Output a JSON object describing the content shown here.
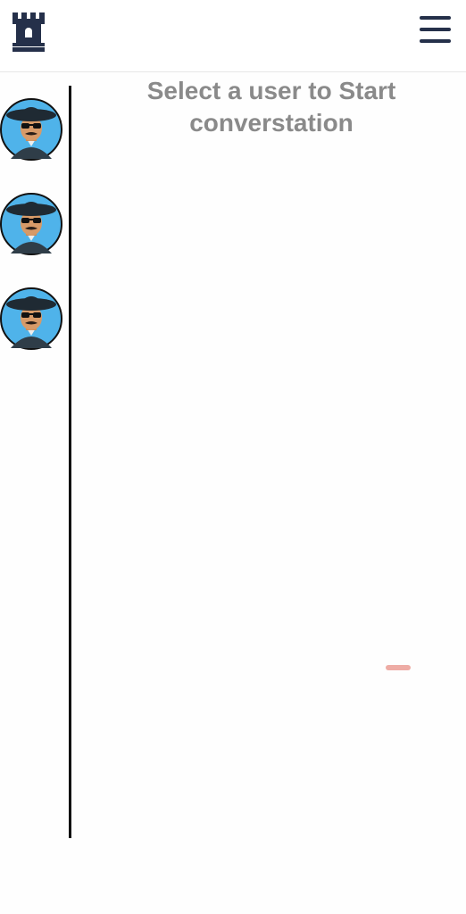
{
  "header": {
    "logo_icon": "castle-tower-icon",
    "menu_icon": "hamburger-menu-icon"
  },
  "sidebar": {
    "users": [
      {
        "avatar": "avatar-man-hat-sunglasses"
      },
      {
        "avatar": "avatar-man-hat-sunglasses"
      },
      {
        "avatar": "avatar-man-hat-sunglasses"
      }
    ]
  },
  "main": {
    "placeholder_line1": "Select a user to Start",
    "placeholder_line2": "converstation"
  },
  "colors": {
    "primary": "#25304a",
    "avatar_bg": "#4fb3ea",
    "placeholder_text": "#8a8a8a"
  }
}
